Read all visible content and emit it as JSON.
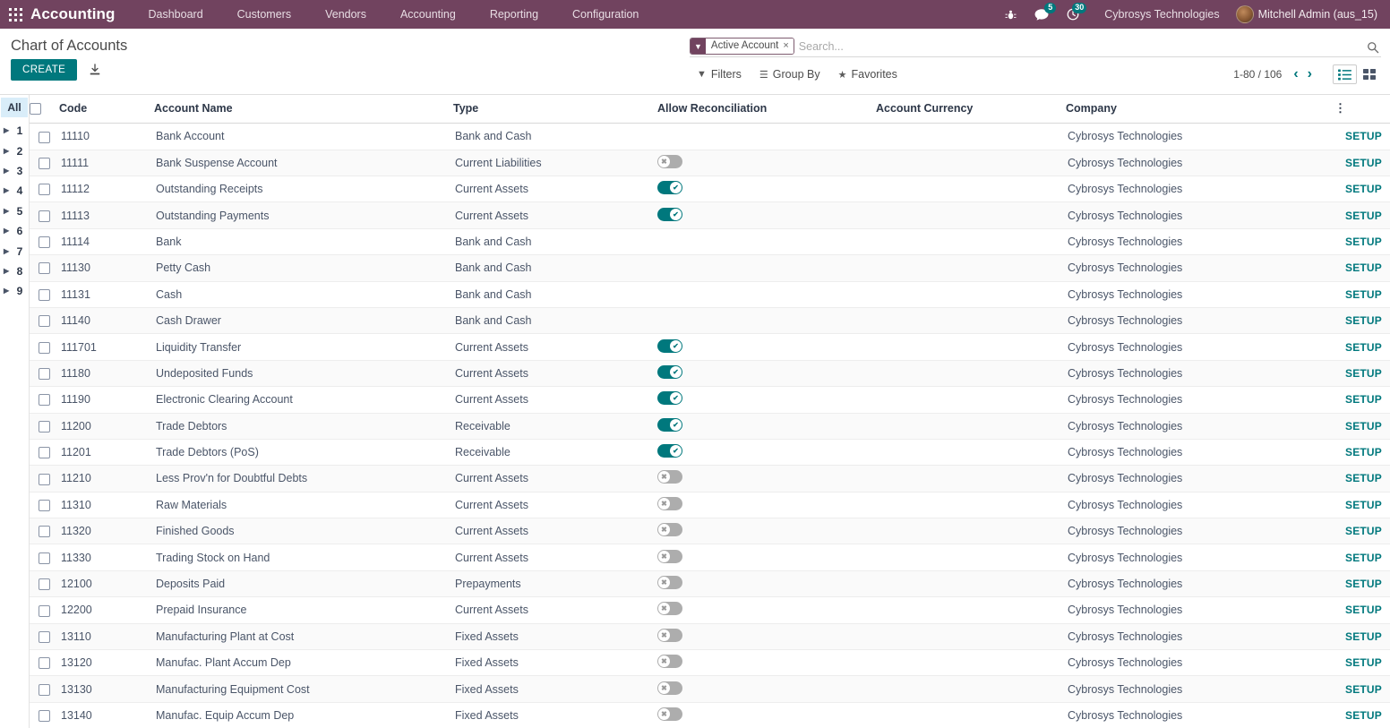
{
  "navbar": {
    "apps_icon": "apps-grid-icon",
    "brand": "Accounting",
    "menu": [
      {
        "label": "Dashboard"
      },
      {
        "label": "Customers"
      },
      {
        "label": "Vendors"
      },
      {
        "label": "Accounting"
      },
      {
        "label": "Reporting"
      },
      {
        "label": "Configuration"
      }
    ],
    "debug_icon": "bug-icon",
    "messages_icon": "messages-icon",
    "messages_count": "5",
    "activities_icon": "clock-icon",
    "activities_count": "30",
    "company": "Cybrosys Technologies",
    "user": "Mitchell Admin (aus_15)",
    "badge_color": "#00787d",
    "background_color": "#71435f"
  },
  "control_panel": {
    "title": "Chart of Accounts",
    "create_label": "CREATE",
    "import_icon": "import-download-icon",
    "accent_color": "#00787d",
    "search": {
      "facet_icon": "filter-icon",
      "facet_label": "Active Account",
      "facet_close": "×",
      "placeholder": "Search...",
      "value": "",
      "magnifier_icon": "search-icon"
    },
    "filters_label": "Filters",
    "filters_icon": "filter-icon",
    "groupby_label": "Group By",
    "groupby_icon": "list-lines-icon",
    "favorites_label": "Favorites",
    "favorites_icon": "star-icon",
    "pager": "1-80 / 106",
    "pager_prev_icon": "chevron-left-icon",
    "pager_next_icon": "chevron-right-icon",
    "view_list_icon": "list-view-icon",
    "view_kanban_icon": "kanban-view-icon",
    "active_view": "list"
  },
  "sidebar": {
    "all_label": "All",
    "items": [
      {
        "label": "1"
      },
      {
        "label": "2"
      },
      {
        "label": "3"
      },
      {
        "label": "4"
      },
      {
        "label": "5"
      },
      {
        "label": "6"
      },
      {
        "label": "7"
      },
      {
        "label": "8"
      },
      {
        "label": "9"
      }
    ]
  },
  "table": {
    "columns": {
      "code": "Code",
      "name": "Account Name",
      "type": "Type",
      "reconciliation": "Allow Reconciliation",
      "currency": "Account Currency",
      "company": "Company"
    },
    "options_icon": "vertical-dots-icon",
    "setup_label": "SETUP",
    "rows": [
      {
        "code": "11110",
        "name": "Bank Account",
        "type": "Bank and Cash",
        "recon": null,
        "currency": "",
        "company": "Cybrosys Technologies"
      },
      {
        "code": "11111",
        "name": "Bank Suspense Account",
        "type": "Current Liabilities",
        "recon": false,
        "currency": "",
        "company": "Cybrosys Technologies"
      },
      {
        "code": "11112",
        "name": "Outstanding Receipts",
        "type": "Current Assets",
        "recon": true,
        "currency": "",
        "company": "Cybrosys Technologies"
      },
      {
        "code": "11113",
        "name": "Outstanding Payments",
        "type": "Current Assets",
        "recon": true,
        "currency": "",
        "company": "Cybrosys Technologies"
      },
      {
        "code": "11114",
        "name": "Bank",
        "type": "Bank and Cash",
        "recon": null,
        "currency": "",
        "company": "Cybrosys Technologies"
      },
      {
        "code": "11130",
        "name": "Petty Cash",
        "type": "Bank and Cash",
        "recon": null,
        "currency": "",
        "company": "Cybrosys Technologies"
      },
      {
        "code": "11131",
        "name": "Cash",
        "type": "Bank and Cash",
        "recon": null,
        "currency": "",
        "company": "Cybrosys Technologies"
      },
      {
        "code": "11140",
        "name": "Cash Drawer",
        "type": "Bank and Cash",
        "recon": null,
        "currency": "",
        "company": "Cybrosys Technologies"
      },
      {
        "code": "111701",
        "name": "Liquidity Transfer",
        "type": "Current Assets",
        "recon": true,
        "currency": "",
        "company": "Cybrosys Technologies"
      },
      {
        "code": "11180",
        "name": "Undeposited Funds",
        "type": "Current Assets",
        "recon": true,
        "currency": "",
        "company": "Cybrosys Technologies"
      },
      {
        "code": "11190",
        "name": "Electronic Clearing Account",
        "type": "Current Assets",
        "recon": true,
        "currency": "",
        "company": "Cybrosys Technologies"
      },
      {
        "code": "11200",
        "name": "Trade Debtors",
        "type": "Receivable",
        "recon": true,
        "currency": "",
        "company": "Cybrosys Technologies"
      },
      {
        "code": "11201",
        "name": "Trade Debtors (PoS)",
        "type": "Receivable",
        "recon": true,
        "currency": "",
        "company": "Cybrosys Technologies"
      },
      {
        "code": "11210",
        "name": "Less Prov'n for Doubtful Debts",
        "type": "Current Assets",
        "recon": false,
        "currency": "",
        "company": "Cybrosys Technologies"
      },
      {
        "code": "11310",
        "name": "Raw Materials",
        "type": "Current Assets",
        "recon": false,
        "currency": "",
        "company": "Cybrosys Technologies"
      },
      {
        "code": "11320",
        "name": "Finished Goods",
        "type": "Current Assets",
        "recon": false,
        "currency": "",
        "company": "Cybrosys Technologies"
      },
      {
        "code": "11330",
        "name": "Trading Stock on Hand",
        "type": "Current Assets",
        "recon": false,
        "currency": "",
        "company": "Cybrosys Technologies"
      },
      {
        "code": "12100",
        "name": "Deposits Paid",
        "type": "Prepayments",
        "recon": false,
        "currency": "",
        "company": "Cybrosys Technologies"
      },
      {
        "code": "12200",
        "name": "Prepaid Insurance",
        "type": "Current Assets",
        "recon": false,
        "currency": "",
        "company": "Cybrosys Technologies"
      },
      {
        "code": "13110",
        "name": "Manufacturing Plant at Cost",
        "type": "Fixed Assets",
        "recon": false,
        "currency": "",
        "company": "Cybrosys Technologies"
      },
      {
        "code": "13120",
        "name": "Manufac. Plant Accum Dep",
        "type": "Fixed Assets",
        "recon": false,
        "currency": "",
        "company": "Cybrosys Technologies"
      },
      {
        "code": "13130",
        "name": "Manufacturing Equipment Cost",
        "type": "Fixed Assets",
        "recon": false,
        "currency": "",
        "company": "Cybrosys Technologies"
      },
      {
        "code": "13140",
        "name": "Manufac. Equip Accum Dep",
        "type": "Fixed Assets",
        "recon": false,
        "currency": "",
        "company": "Cybrosys Technologies"
      }
    ]
  }
}
